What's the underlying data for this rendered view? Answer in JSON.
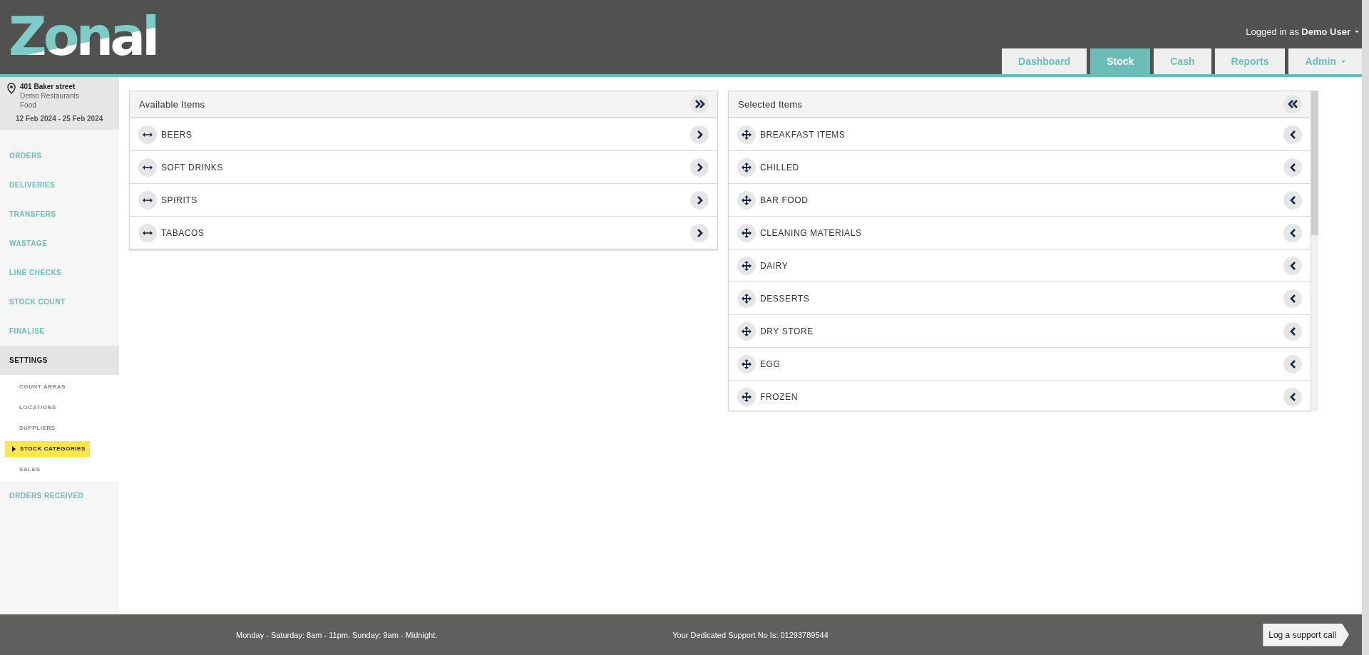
{
  "header": {
    "logo": "Zonal",
    "user": "Logged in as **Demo User**",
    "tabs": [
      {
        "label": "Dashboard",
        "selected": false,
        "dropdown": false
      },
      {
        "label": "Stock",
        "selected": true,
        "dropdown": false
      },
      {
        "label": "Cash",
        "selected": false,
        "dropdown": false
      },
      {
        "label": "Reports",
        "selected": false,
        "dropdown": false
      },
      {
        "label": "Admin",
        "selected": false,
        "dropdown": true
      }
    ]
  },
  "sidebar": {
    "location": {
      "site": "401 Baker street",
      "company": "Demo Restaurants",
      "category": "Food",
      "period": "12 Feb 2024 - 25 Feb 2024"
    },
    "items": [
      {
        "label": "ORDERS",
        "selected": false
      },
      {
        "label": "DELIVERIES",
        "selected": false
      },
      {
        "label": "TRANSFERS",
        "selected": false
      },
      {
        "label": "WASTAGE",
        "selected": false
      },
      {
        "label": "LINE CHECKS",
        "selected": false
      },
      {
        "label": "STOCK COUNT",
        "selected": false
      },
      {
        "label": "FINALISE",
        "selected": false
      },
      {
        "label": "SETTINGS",
        "selected": true,
        "expanded": true,
        "children": [
          {
            "label": "COUNT AREAS",
            "selected": false
          },
          {
            "label": "LOCATIONS",
            "selected": false
          },
          {
            "label": "SUPPLIERS",
            "selected": false
          },
          {
            "label": "STOCK CATEGORIES",
            "selected": true
          },
          {
            "label": "SALES",
            "selected": false
          }
        ]
      },
      {
        "label": "ORDERS RECEIVED",
        "selected": false
      }
    ]
  },
  "panels": [
    {
      "kind": "available",
      "title": "Available Items",
      "items": [
        "BEERS",
        "SOFT DRINKS",
        "SPIRITS",
        "TABACOS"
      ]
    },
    {
      "kind": "selected",
      "title": "Selected Items",
      "items": [
        "BREAKFAST ITEMS",
        "CHILLED",
        "BAR FOOD",
        "CLEANING MATERIALS",
        "DAIRY",
        "DESSERTS",
        "DRY STORE",
        "EGG",
        "FROZEN"
      ]
    }
  ],
  "footer": {
    "hours": "Monday - Saturday: 8am - 11pm. Sunday: 9am - Midnight.",
    "support": "Your Dedicated Support No Is: 01293789544",
    "button": "Log a support call"
  }
}
